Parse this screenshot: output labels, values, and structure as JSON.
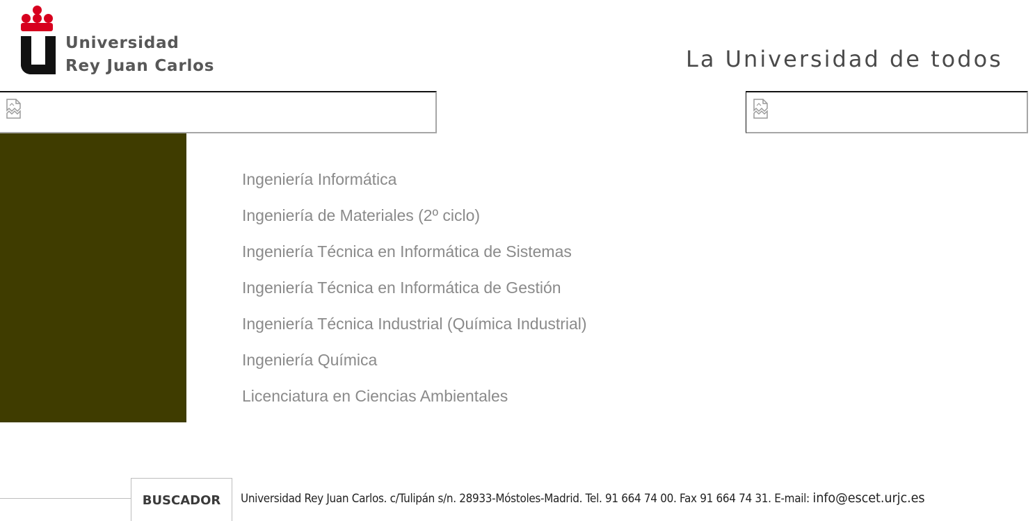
{
  "header": {
    "logo_line1": "Universidad",
    "logo_line2": "Rey Juan Carlos",
    "tagline": "La Universidad de todos"
  },
  "icons": {
    "broken_image_left": "broken-image-icon",
    "broken_image_right": "broken-image-icon",
    "logo_crown": "crown-icon"
  },
  "colors": {
    "sidebar": "#3f3c00",
    "menu_text": "#8a8a8a",
    "logo_red": "#d7001e",
    "logo_black": "#111111"
  },
  "menu": {
    "items": [
      {
        "label": "Ingeniería Informática"
      },
      {
        "label": "Ingeniería de Materiales (2º ciclo)"
      },
      {
        "label": "Ingeniería Técnica en Informática de Sistemas"
      },
      {
        "label": "Ingeniería Técnica en Informática de Gestión"
      },
      {
        "label": "Ingeniería Técnica Industrial (Química Industrial)"
      },
      {
        "label": "Ingeniería Química"
      },
      {
        "label": "Licenciatura en Ciencias Ambientales"
      }
    ]
  },
  "footer": {
    "buscador_label": "BUSCADOR",
    "address": "Universidad Rey Juan Carlos. c/Tulipán s/n. 28933-Móstoles-Madrid. Tel. 91 664 74 00. Fax 91 664 74 31. E-mail: ",
    "email": "info@escet.urjc.es"
  }
}
